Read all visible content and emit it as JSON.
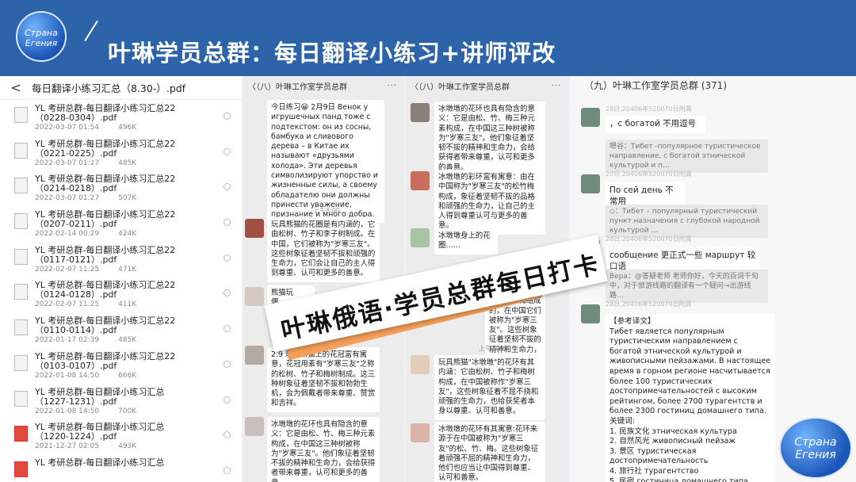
{
  "banner": {
    "logo_text": "Страна Егения",
    "title": "叶琳学员总群：每日翻译小练习+讲师评改"
  },
  "panel1": {
    "back_glyph": "<",
    "title": "每日翻译小练习汇总（8.30-）.pdf",
    "files": [
      {
        "name": "YL 考研总群-每日翻译小练习汇总22（0228-0304）.pdf",
        "date": "2022-03-07 01:54",
        "size": "496K",
        "icon": "pdf-icon"
      },
      {
        "name": "YL 考研总群-每日翻译小练习汇总22（0221-0225）.pdf",
        "date": "2022-03-07 01:27",
        "size": "485K",
        "icon": "pdf-icon"
      },
      {
        "name": "YL 考研总群-每日翻译小练习汇总22（0214-0218）.pdf",
        "date": "2022-03-07 01:27",
        "size": "507K",
        "icon": "pdf-icon"
      },
      {
        "name": "YL 考研总群-每日翻译小练习汇总22（0207-0211）.pdf",
        "date": "2022-02-14 00:29",
        "size": "424K",
        "icon": "pdf-icon"
      },
      {
        "name": "YL 考研总群-每日翻译小练习汇总22（0117-0121）.pdf",
        "date": "2022-02-07 11:25",
        "size": "471K",
        "icon": "pdf-icon"
      },
      {
        "name": "YL 考研总群-每日翻译小练习汇总22（0124-0128）.pdf",
        "date": "2022-02-07 11:25",
        "size": "411K",
        "icon": "pdf-icon"
      },
      {
        "name": "YL 考研总群-每日翻译小练习汇总22（0110-0114）.pdf",
        "date": "2022-01-17 02:39",
        "size": "485K",
        "icon": "pdf-icon"
      },
      {
        "name": "YL 考研总群-每日翻译小练习汇总22（0103-0107）.pdf",
        "date": "2022-01-08 14:50",
        "size": "666K",
        "icon": "pdf-icon"
      },
      {
        "name": "YL 考研总群-每日翻译小练习汇总（1227-1231）.pdf",
        "date": "2022-01-08 14:50",
        "size": "700K",
        "icon": "pdf-icon"
      },
      {
        "name": "YL 考研总群-每日翻译小练习汇总（1220-1224）.pdf",
        "date": "2021-12-27 02:05",
        "size": "493K",
        "icon": "pdf-red-icon"
      },
      {
        "name": "YL 考研总群-每日翻译小练习汇总",
        "date": "",
        "size": "",
        "icon": "pdf-red-icon"
      }
    ]
  },
  "panel2": {
    "header": "〈（八）叶琳工作室学员总群",
    "msg1": "今日练习😀\n2月9日\nВенок у игрушечных панд тоже с подтекстом: он из сосны, бамбука и сливового дерева – в Китае их называют «друзьями холода». Эти деревья символизируют упорство и жизненные силы, а своему обладателю они должны принести уважение, признание и много добра.",
    "time1": "上午8:00",
    "msg2": "玩具熊猫的花圈是有内涵的，它由松树、竹子和李子树制成。在中国，它们被称为\"岁寒三友\"。这些树象征着坚韧不拔和顽强的生命力，它们会让自己的主人得到尊重、认可和更多的善意。",
    "msg3": "熊猫玩偶……",
    "msg4": "2.9\n玩具熊猫上的花冠富有寓意，花冠用素有\"岁寒三友\"之称的松树、竹子和梅树制成。这三种树象征着坚韧不拔和勃勃生机，会为佩戴者带来尊重、赞赏和吉祥。",
    "msg5": "冰墩墩的花环也具有隐含的意义：它是由松、竹、梅三种元素构成，在中国这三种树被称为\"岁寒三友\"。他们象征着坚韧不拔的精神和生命力，会给获得者带来尊重，认可和更多的善意。"
  },
  "panel3": {
    "header": "〈（八）叶琳工作室学员总群",
    "msg1": "冰墩墩的花环也具有隐含的意义：它是由松、竹、梅三种元素构成，在中国这三种树被称为\"岁寒三友\"。他们象征着坚韧不拔的精神和生命力，会给获得者带来尊重，认可和更多的善意。",
    "msg2": "冰墩墩的彩环富有寓意：由在中国称为\"岁寒三友\"的松竹梅构成，象征着坚韧不拔的品格和顽强的生命力，让自己的主人得到尊重认可与更多的善意。",
    "msg3": "冰墩墩身上的花圈……",
    "msg4": "……它们是由松、竹、梅组成的，在中国它们被称为\"岁寒三友\"。这些树象征着坚韧不拔的精神和生命力，会给主人带来尊重，认可。",
    "time1": "上午10:35",
    "msg5": "玩具熊猫\"冰墩墩\"的花环有其内涵：它由松树、竹子和梅树构成，在中国被称作\"岁寒三友\"，这些树象征着不屈不挠和顽强的生命力，也给获奖者本身以尊重、认可和善意。",
    "msg6": "冰墩墩的花环有其寓意:花环来源于在中国被称为\"岁寒三友\"的松、竹、梅。这些树象征着顽强不屈的精神和生命力，他们也应当让中国得到尊重、认可和善意。"
  },
  "panel4": {
    "header": "（九）叶琳工作室学员总群 (371)",
    "names": [
      "28日,20406年520070日附属",
      "20日,20406年520070日附属",
      "28日,20406年520070日附属",
      "28日,20406年520070日附属"
    ],
    "msg1": "，с богатой 不用逗号",
    "quote1": "嗯谷：Тибет -популярное туристическое направление, с богатой этнической культурой и п…",
    "msg2": "По сей день 不常用",
    "quote2": "◇：Тибет – популярный туристический пункт назначения с глубокой народной культурой …",
    "msg3": "сообщение 更正式一些 маршрут 较口语",
    "quote3": "Вера：@答疑老师 老师你好，今天的百词千句中，对于旅游线路的翻译有一个疑问→出游线路…",
    "msg4": "【参考译文】\nТибет является популярным туристическим направлением с богатой этнической культурой и живописными пейзажами. В настоящее время в горном регионе насчитывается более 100 туристических достопримечательностей с высоким рейтингом, более 2700 турагентств и более 2300 гостиниц домашнего типа.\n关键词:\n1. 民族文化 этническая культура\n2. 自然风光 живописный пейзаж\n3. 景区 туристическая достопримечательность\n4. 旅行社 турагентство\n5. 民宿 гостиница домашнего типа"
  },
  "overlay": {
    "stamp_text": "叶琳俄语·学员总群每日打卡",
    "logo_text": "Страна Егения"
  },
  "colors": {
    "banner": "#2d63a8",
    "stamp_accent": "#f5a05a"
  }
}
